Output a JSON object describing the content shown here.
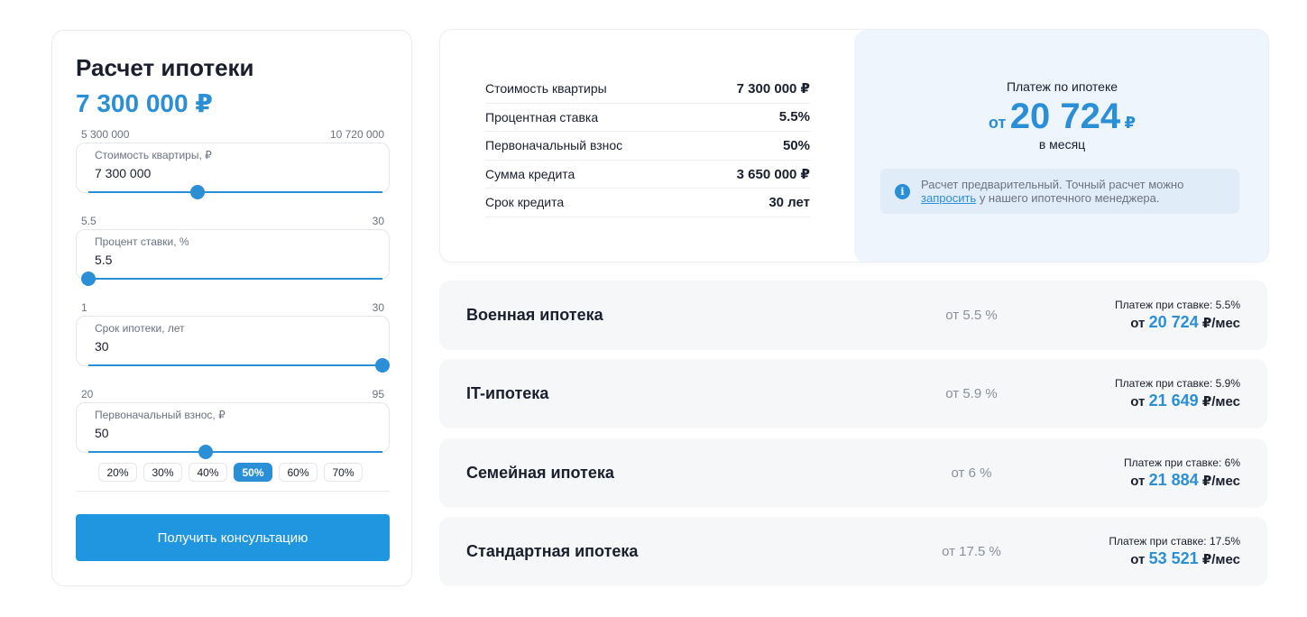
{
  "calculator": {
    "title": "Расчет ипотеки",
    "price": "7 300 000 ₽",
    "fields": [
      {
        "min": "5 300 000",
        "max": "10 720 000",
        "label": "Стоимость квартиры, ₽",
        "value": "7 300 000",
        "slider_fraction": 0.37
      },
      {
        "min": "5.5",
        "max": "30",
        "label": "Процент ставки, %",
        "value": "5.5",
        "slider_fraction": 0.0
      },
      {
        "min": "1",
        "max": "30",
        "label": "Срок ипотеки, лет",
        "value": "30",
        "slider_fraction": 1.0
      },
      {
        "min": "20",
        "max": "95",
        "label": "Первоначальный взнос, ₽",
        "value": "50",
        "slider_fraction": 0.4
      }
    ],
    "chips": [
      "20%",
      "30%",
      "40%",
      "50%",
      "60%",
      "70%"
    ],
    "active_chip": "50%",
    "cta_label": "Получить консультацию"
  },
  "summary": {
    "rows": [
      {
        "label": "Стоимость квартиры",
        "value": "7 300 000 ₽"
      },
      {
        "label": "Процентная ставка",
        "value": "5.5%"
      },
      {
        "label": "Первоначальный взнос",
        "value": "50%"
      },
      {
        "label": "Сумма кредита",
        "value": "3 650 000 ₽"
      },
      {
        "label": "Срок кредита",
        "value": "30 лет"
      }
    ],
    "payment_title": "Платеж по ипотеке",
    "payment_from": "от",
    "payment_amount": "20 724",
    "payment_currency": "₽",
    "payment_period": "в месяц",
    "note_text_before": "Расчет предварительный. Точный расчет можно",
    "note_link": "запросить",
    "note_text_after": "у нашего ипотечного менеджера."
  },
  "programs": [
    {
      "name": "Военная ипотека",
      "rate": "от 5.5 %",
      "payment_label": "Платеж при ставке: 5.5%",
      "from": "от",
      "amount": "20 724",
      "unit": "₽/мес"
    },
    {
      "name": "IT-ипотека",
      "rate": "от 5.9 %",
      "payment_label": "Платеж при ставке: 5.9%",
      "from": "от",
      "amount": "21 649",
      "unit": "₽/мес"
    },
    {
      "name": "Семейная ипотека",
      "rate": "от 6 %",
      "payment_label": "Платеж при ставке: 6%",
      "from": "от",
      "amount": "21 884",
      "unit": "₽/мес"
    },
    {
      "name": "Стандартная ипотека",
      "rate": "от 17.5 %",
      "payment_label": "Платеж при ставке: 17.5%",
      "from": "от",
      "amount": "53 521",
      "unit": "₽/мес"
    }
  ],
  "colors": {
    "accent": "#2a8fd6",
    "cta": "#2196e0",
    "payment_bg": "#eef5fd"
  }
}
